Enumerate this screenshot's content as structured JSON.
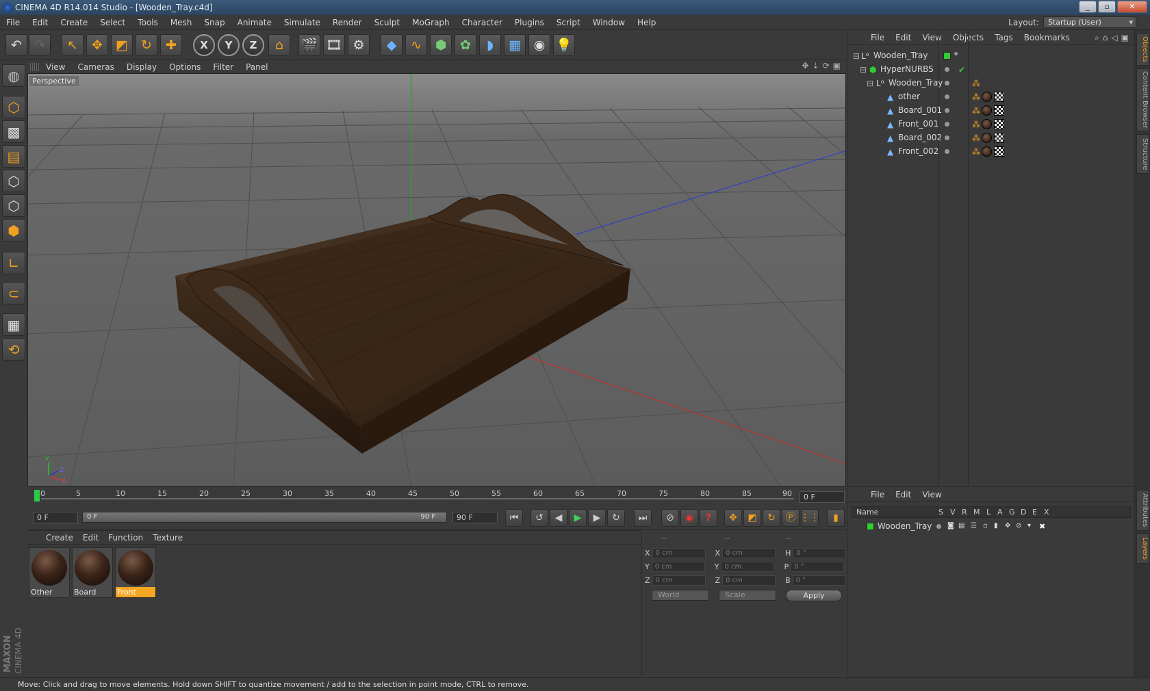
{
  "window": {
    "title": "CINEMA 4D R14.014 Studio - [Wooden_Tray.c4d]",
    "controls": [
      "_",
      "▫",
      "✕"
    ]
  },
  "menu": [
    "File",
    "Edit",
    "Create",
    "Select",
    "Tools",
    "Mesh",
    "Snap",
    "Animate",
    "Simulate",
    "Render",
    "Sculpt",
    "MoGraph",
    "Character",
    "Plugins",
    "Script",
    "Window",
    "Help"
  ],
  "layout": {
    "label": "Layout:",
    "value": "Startup (User)"
  },
  "viewport": {
    "menu": [
      "View",
      "Cameras",
      "Display",
      "Options",
      "Filter",
      "Panel"
    ],
    "label": "Perspective",
    "axis_labels": {
      "y": "Y",
      "z": "Z",
      "x": "X"
    }
  },
  "timeline": {
    "ticks": [
      "0",
      "5",
      "10",
      "15",
      "20",
      "25",
      "30",
      "35",
      "40",
      "45",
      "50",
      "55",
      "60",
      "65",
      "70",
      "75",
      "80",
      "85",
      "90"
    ],
    "current_frame": "0 F",
    "start_field": "0 F",
    "scrub_start": "0 F",
    "scrub_end": "90 F",
    "end_field": "90 F"
  },
  "materials": {
    "menu": [
      "Create",
      "Edit",
      "Function",
      "Texture"
    ],
    "items": [
      {
        "name": "Other",
        "selected": false
      },
      {
        "name": "Board",
        "selected": false
      },
      {
        "name": "Front",
        "selected": true
      }
    ]
  },
  "coords": {
    "headers": [
      "--",
      "--",
      "--"
    ],
    "rows": [
      {
        "a": "X",
        "av": "0 cm",
        "b": "X",
        "bv": "0 cm",
        "c": "H",
        "cv": "0 °"
      },
      {
        "a": "Y",
        "av": "0 cm",
        "b": "Y",
        "bv": "0 cm",
        "c": "P",
        "cv": "0 °"
      },
      {
        "a": "Z",
        "av": "0 cm",
        "b": "Z",
        "bv": "0 cm",
        "c": "B",
        "cv": "0 °"
      }
    ],
    "world": "World",
    "scale": "Scale",
    "apply": "Apply"
  },
  "objects": {
    "menu": [
      "File",
      "Edit",
      "View",
      "Objects",
      "Tags",
      "Bookmarks"
    ],
    "items": [
      {
        "name": "Wooden_Tray",
        "indent": 0,
        "icon": "null"
      },
      {
        "name": "HyperNURBS",
        "indent": 1,
        "icon": "nurbs"
      },
      {
        "name": "Wooden_Tray",
        "indent": 2,
        "icon": "null"
      },
      {
        "name": "other",
        "indent": 3,
        "icon": "poly"
      },
      {
        "name": "Board_001",
        "indent": 3,
        "icon": "poly"
      },
      {
        "name": "Front_001",
        "indent": 3,
        "icon": "poly"
      },
      {
        "name": "Board_002",
        "indent": 3,
        "icon": "poly"
      },
      {
        "name": "Front_002",
        "indent": 3,
        "icon": "poly"
      }
    ]
  },
  "side_tabs": [
    "Objects",
    "Content Browser",
    "Structure"
  ],
  "side_tabs_bottom": [
    "Attributes",
    "Layers"
  ],
  "layers": {
    "menu": [
      "File",
      "Edit",
      "View"
    ],
    "columns": [
      "Name",
      "S",
      "V",
      "R",
      "M",
      "L",
      "A",
      "G",
      "D",
      "E",
      "X"
    ],
    "row_name": "Wooden_Tray"
  },
  "status": "Move: Click and drag to move elements. Hold down SHIFT to quantize movement / add to the selection in point mode, CTRL to remove.",
  "brand": {
    "maxon": "MAXON",
    "product": "CINEMA 4D"
  },
  "colors": {
    "accent": "#f5a623",
    "green": "#33cc33",
    "bg": "#3a3a3a"
  }
}
